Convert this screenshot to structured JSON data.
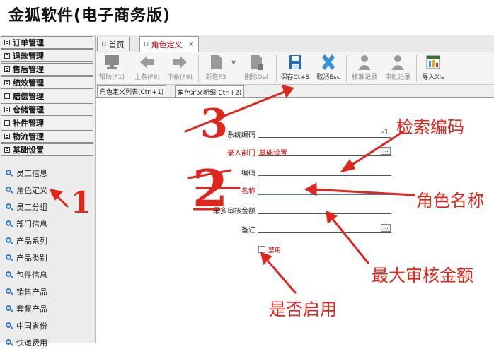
{
  "app": {
    "title": "金狐软件(电子商务版)"
  },
  "sidebar": {
    "menus": [
      {
        "label": "订单管理"
      },
      {
        "label": "退款管理"
      },
      {
        "label": "售后管理"
      },
      {
        "label": "绩效管理"
      },
      {
        "label": "赔偿管理"
      },
      {
        "label": "仓储管理"
      },
      {
        "label": "补件管理"
      },
      {
        "label": "物流管理"
      },
      {
        "label": "基础设置"
      }
    ],
    "items": [
      {
        "label": "员工信息"
      },
      {
        "label": "角色定义"
      },
      {
        "label": "员工分组"
      },
      {
        "label": "部门信息"
      },
      {
        "label": "产品系列"
      },
      {
        "label": "产品类别"
      },
      {
        "label": "包件信息"
      },
      {
        "label": "销售产品"
      },
      {
        "label": "套餐产品"
      },
      {
        "label": "中国省份"
      },
      {
        "label": "快递费用"
      }
    ]
  },
  "tabs": [
    {
      "label": "首页",
      "icon": "window-icon"
    },
    {
      "label": "角色定义",
      "icon": "window-icon",
      "close": "×"
    }
  ],
  "toolbar": {
    "help": "帮助(F1)",
    "prev": "上条(F8)",
    "next": "下条(F9)",
    "add": "新增F3",
    "delete": "删除Del",
    "save": "保存Ct+S",
    "cancel": "取消Esc",
    "approve": "核准记录",
    "review": "审批记录",
    "export": "导入Xls"
  },
  "subtabs": [
    {
      "label": "角色定义列表(Ctrl+1)"
    },
    {
      "label": "角色定义明细(Ctrl+2)"
    }
  ],
  "form": {
    "sys_code": {
      "label": "系统编码",
      "value": "-1"
    },
    "dept": {
      "label": "录入部门",
      "value": "基础设置",
      "button": "..."
    },
    "code": {
      "label": "编码",
      "value": ""
    },
    "name": {
      "label": "名称",
      "value": ""
    },
    "max_amount": {
      "label": "最多审核金额",
      "value": ""
    },
    "remark": {
      "label": "备注",
      "value": "",
      "button": "..."
    },
    "disabled": {
      "label": "禁用",
      "checked": false
    }
  },
  "annotations": {
    "n1": "1",
    "n2": "2",
    "n3": "3",
    "search_code": "检索编码",
    "role_name": "角色名称",
    "max_amount": "最大审核金额",
    "enable": "是否启用"
  },
  "colors": {
    "annotation": "#e0251c",
    "active_tab": "#c00000",
    "required_label": "#d60000"
  }
}
